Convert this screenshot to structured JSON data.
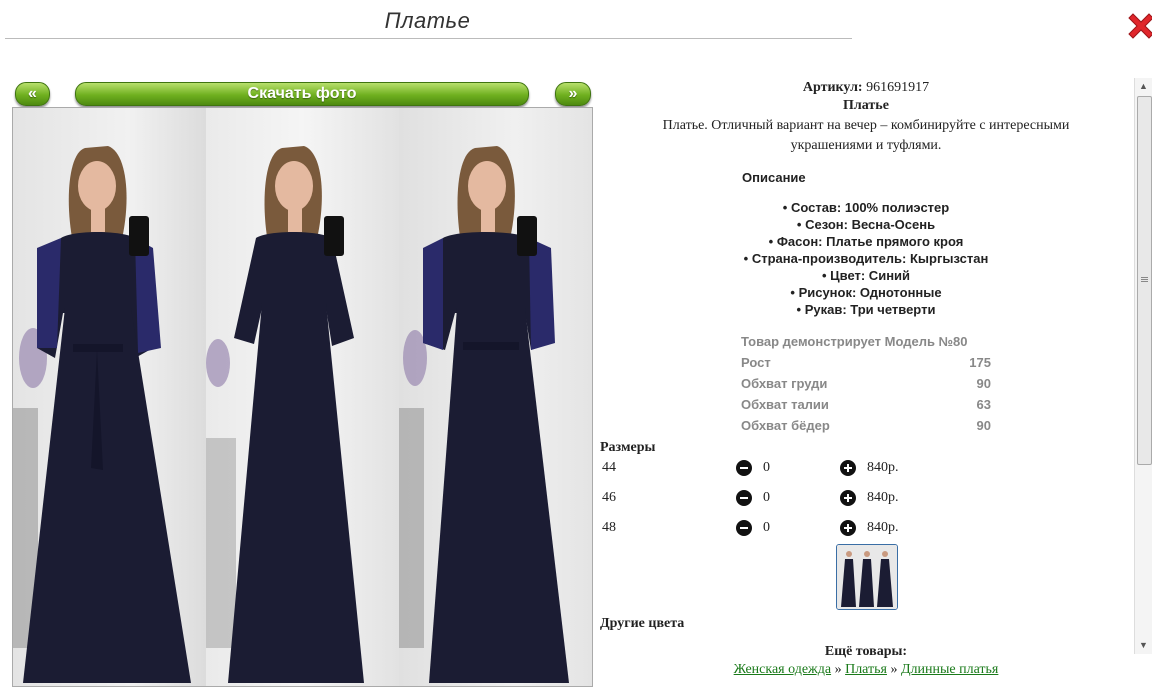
{
  "header": {
    "title": "Платье"
  },
  "close": {
    "icon": "close-icon",
    "color": "#e0262b"
  },
  "gallery": {
    "prev_label": "«",
    "download_label": "Скачать фото",
    "next_label": "»"
  },
  "product": {
    "article_label": "Артикул:",
    "article_value": "961691917",
    "name": "Платье",
    "description": "Платье. Отличный вариант на вечер – комбинируйте с интересными украшениями и туфлями.",
    "description_heading": "Описание",
    "features": [
      "Состав: 100% полиэстер",
      "Сезон: Весна-Осень",
      "Фасон: Платье прямого кроя",
      "Страна-производитель: Кыргызстан",
      "Цвет: Синий",
      "Рисунок: Однотонные",
      "Рукав: Три четверти"
    ]
  },
  "model": {
    "heading": "Товар демонстрирует Модель №80",
    "rows": [
      {
        "label": "Рост",
        "value": "175"
      },
      {
        "label": "Обхват груди",
        "value": "90"
      },
      {
        "label": "Обхват талии",
        "value": "63"
      },
      {
        "label": "Обхват бёдер",
        "value": "90"
      }
    ]
  },
  "sizes": {
    "heading": "Размеры",
    "rows": [
      {
        "size": "44",
        "qty": "0",
        "price": "840р."
      },
      {
        "size": "46",
        "qty": "0",
        "price": "840р."
      },
      {
        "size": "48",
        "qty": "0",
        "price": "840р."
      }
    ]
  },
  "other_colors": {
    "heading": "Другие цвета"
  },
  "more": {
    "heading": "Ещё товары:",
    "crumbs": [
      "Женская одежда",
      "Платья",
      "Длинные платья"
    ],
    "separator": "»"
  },
  "colors": {
    "accent_green": "#6fb01f",
    "link_green": "#1a7a1a",
    "dress": "#1b1c33"
  }
}
